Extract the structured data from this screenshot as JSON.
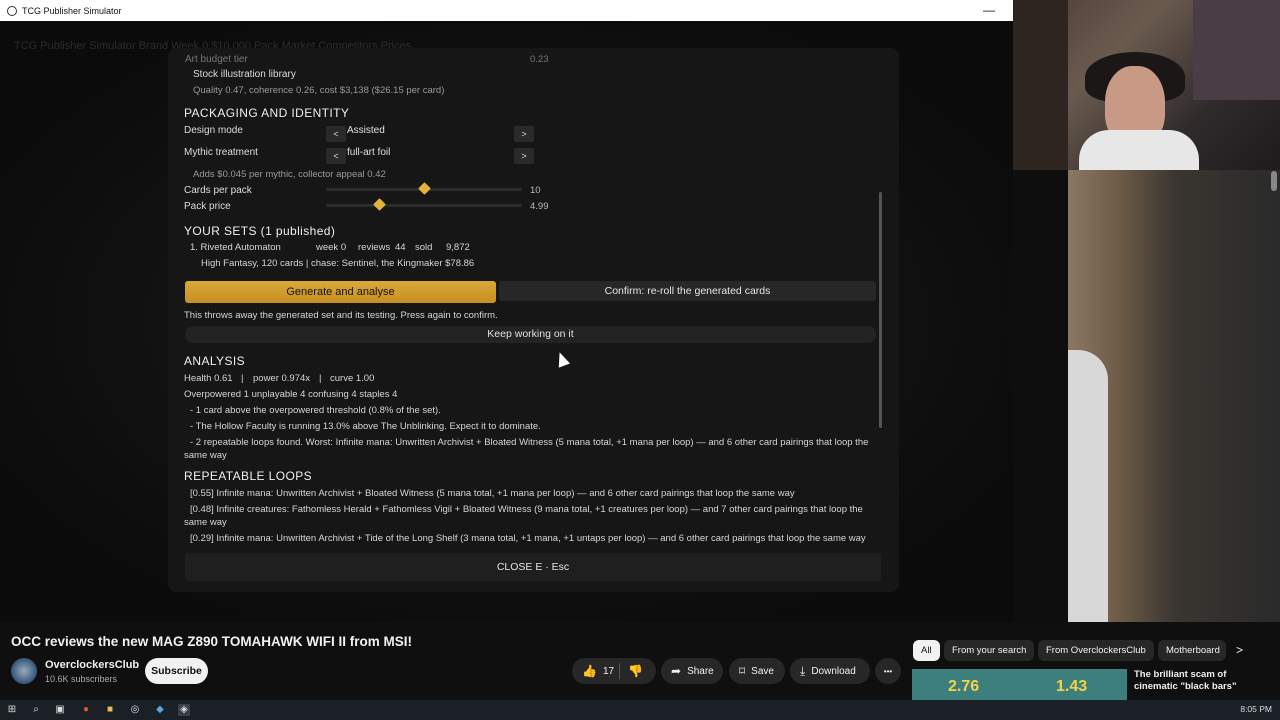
{
  "window": {
    "title": "TCG Publisher Simulator",
    "minimize": "—",
    "close": "×"
  },
  "background": {
    "header_text": "TCG Publisher Simulator    Brand    Week 0    $10,000    Pack Market    Competitors    Prices"
  },
  "panel": {
    "art": {
      "label": "Art budget tier",
      "value": "0.23",
      "source": "Stock illustration library",
      "summary": "Quality 0.47, coherence 0.26, cost $3,138  ($26.15 per card)"
    },
    "packaging": {
      "heading": "PACKAGING AND IDENTITY",
      "design_mode": {
        "label": "Design mode",
        "prev": "<",
        "value": "Assisted",
        "next": ">"
      },
      "mythic": {
        "label": "Mythic treatment",
        "prev": "<",
        "value": "full-art foil",
        "next": ">"
      },
      "mythic_note": "Adds $0.045 per mythic, collector appeal 0.42",
      "cards_per_pack": {
        "label": "Cards per pack",
        "value": "10",
        "level": 0.5
      },
      "pack_price": {
        "label": "Pack price",
        "value": "4.99",
        "level": 0.27
      }
    },
    "sets": {
      "heading": "YOUR SETS  (1 published)",
      "items": [
        {
          "name": "1. Riveted Automaton",
          "week": "week 0",
          "reviews_label": "reviews",
          "reviews": "44",
          "sold_label": "sold",
          "sold": "9,872",
          "details": "High Fantasy, 120 cards  |  chase: Sentinel, the Kingmaker $78.86"
        }
      ]
    },
    "actions": {
      "generate": "Generate and analyse",
      "confirm": "Confirm: re-roll the generated cards",
      "warning": "This throws away the generated set and its testing. Press again to confirm.",
      "keep": "Keep working on it"
    },
    "analysis": {
      "heading": "ANALYSIS",
      "health": "Health 0.61",
      "power": "power 0.974x",
      "curve": "curve 1.00",
      "counts": "Overpowered 1    unplayable 4    confusing 4    staples 4",
      "notes": [
        "- 1 card above the overpowered threshold (0.8% of the set).",
        "- The Hollow Faculty is running 13.0% above The Unblinking. Expect it to dominate.",
        "- 2 repeatable loops found. Worst: Infinite mana: Unwritten Archivist + Bloated Witness (5 mana total, +1 mana per loop) — and 6 other card pairings that loop the same way"
      ]
    },
    "loops": {
      "heading": "REPEATABLE LOOPS",
      "items": [
        "[0.55] Infinite mana: Unwritten Archivist + Bloated Witness (5 mana total, +1 mana per loop) — and 6 other card pairings that loop the same way",
        "[0.48] Infinite creatures: Fathomless Herald + Fathomless Vigil + Bloated Witness (9 mana total, +1 creatures per loop) — and 7 other card pairings that loop the same way",
        "[0.29] Infinite mana: Unwritten Archivist + Tide of the Long Shelf (3 mana total, +1 mana, +1 untaps per loop) — and 6 other card pairings that loop the same way"
      ]
    },
    "close": "CLOSE    E  ·  Esc"
  },
  "youtube": {
    "video_title": "OCC reviews the new MAG Z890 TOMAHAWK WIFI II from MSI!",
    "channel": "OverclockersClub",
    "subscribers": "10.6K subscribers",
    "subscribe": "Subscribe",
    "likes": "17",
    "share": "Share",
    "save": "Save",
    "download": "Download",
    "more": "•••",
    "chips": [
      "All",
      "From your search",
      "From OverclockersClub",
      "Motherboard"
    ],
    "chip_next": ">",
    "recommendation": {
      "title": "The brilliant scam of cinematic \"black bars\"",
      "thumb_values": [
        "2.76",
        "1.43"
      ]
    }
  },
  "taskbar": {
    "time": "8:05 PM"
  },
  "colors": {
    "accent": "#d9a93a",
    "warning": "#d96e5c",
    "good": "#8dcf6d"
  }
}
